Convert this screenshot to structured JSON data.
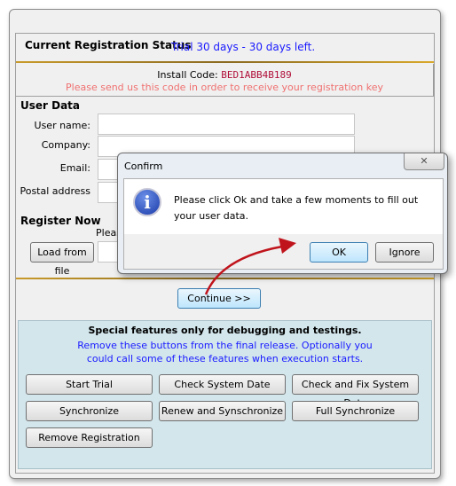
{
  "status": {
    "title": "Current Registration Status",
    "value": "Trial 30 days - 30 days left."
  },
  "install": {
    "label": "Install Code:",
    "code": "BED1ABB4B189",
    "note": "Please send us this code in order to receive your registration key"
  },
  "user_data": {
    "heading": "User Data",
    "fields": [
      {
        "label": "User name:",
        "value": ""
      },
      {
        "label": "Company:",
        "value": ""
      },
      {
        "label": "Email:",
        "value": ""
      },
      {
        "label": "Postal address",
        "value": ""
      }
    ]
  },
  "register": {
    "heading": "Register Now",
    "hint_partial": "Pleas",
    "load_button": "Load from file"
  },
  "continue_button": "Continue >>",
  "special": {
    "title": "Special features only for debugging and testings.",
    "note1": "Remove these buttons from the final release. Optionally you",
    "note2": "could call some of these features when execution starts.",
    "buttons": [
      "Start Trial",
      "Check System Date",
      "Check and Fix System Date",
      "Synchronize",
      "Renew and Synschronize",
      "Full Synchronize",
      "Remove Registration"
    ]
  },
  "dialog": {
    "title": "Confirm",
    "message": "Please click Ok and take a few moments to fill out your user data.",
    "icon": "info-icon",
    "ok": "OK",
    "ignore": "Ignore",
    "close": "✕"
  },
  "colors": {
    "accent_blue": "#1a1aff",
    "code_red": "#b0103a",
    "note_pink": "#f07070",
    "special_bg": "#d2e6ec",
    "arrow": "#c0141c"
  }
}
